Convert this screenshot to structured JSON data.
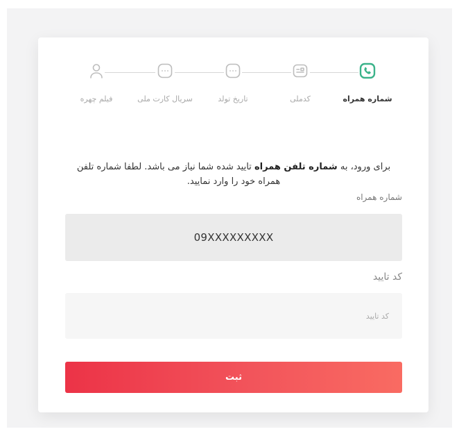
{
  "steps": [
    {
      "label": "شماره همراه",
      "icon": "phone-icon",
      "active": true
    },
    {
      "label": "کدملی",
      "icon": "id-card-icon",
      "active": false
    },
    {
      "label": "تاریخ تولد",
      "icon": "chat-bubble-icon",
      "active": false
    },
    {
      "label": "سریال کارت ملی",
      "icon": "chat-bubble-icon",
      "active": false
    },
    {
      "label": "فیلم چهره",
      "icon": "user-icon",
      "active": false
    }
  ],
  "intro": {
    "before": "برای ورود، به ",
    "bold": "شماره تلفن همراه",
    "after": " تایید شده شما نیاز می باشد. لطفا شماره تلفن همراه خود را وارد نمایید."
  },
  "form": {
    "phone_label": "شماره همراه",
    "phone_value": "09XXXXXXXXX",
    "code_label": "کد تایید",
    "code_placeholder": "کد تایید",
    "submit_label": "ثبت"
  },
  "colors": {
    "active_step": "#3bb38a",
    "button_start": "#ec3347",
    "button_end": "#f96b62"
  }
}
